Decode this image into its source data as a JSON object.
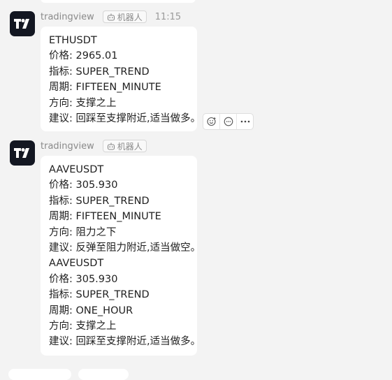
{
  "messages": [
    {
      "sender": "tradingview",
      "badge": "机器人",
      "time": "11:15",
      "lines": [
        "ETHUSDT",
        "价格: 2965.01",
        "指标: SUPER_TREND",
        "周期: FIFTEEN_MINUTE",
        "方向: 支撑之上",
        "建议: 回踩至支撑附近,适当做多。"
      ]
    },
    {
      "sender": "tradingview",
      "badge": "机器人",
      "time": "",
      "lines": [
        "AAVEUSDT",
        "价格: 305.930",
        "指标: SUPER_TREND",
        "周期: FIFTEEN_MINUTE",
        "方向: 阻力之下",
        "建议: 反弹至阻力附近,适当做空。",
        "AAVEUSDT",
        "价格: 305.930",
        "指标: SUPER_TREND",
        "周期: ONE_HOUR",
        "方向: 支撑之上",
        "建议: 回踩至支撑附近,适当做多。"
      ]
    }
  ],
  "hover_actions": [
    {
      "icon": "emoji-reaction-icon"
    },
    {
      "icon": "reply-comment-icon"
    },
    {
      "icon": "more-options-icon"
    }
  ]
}
